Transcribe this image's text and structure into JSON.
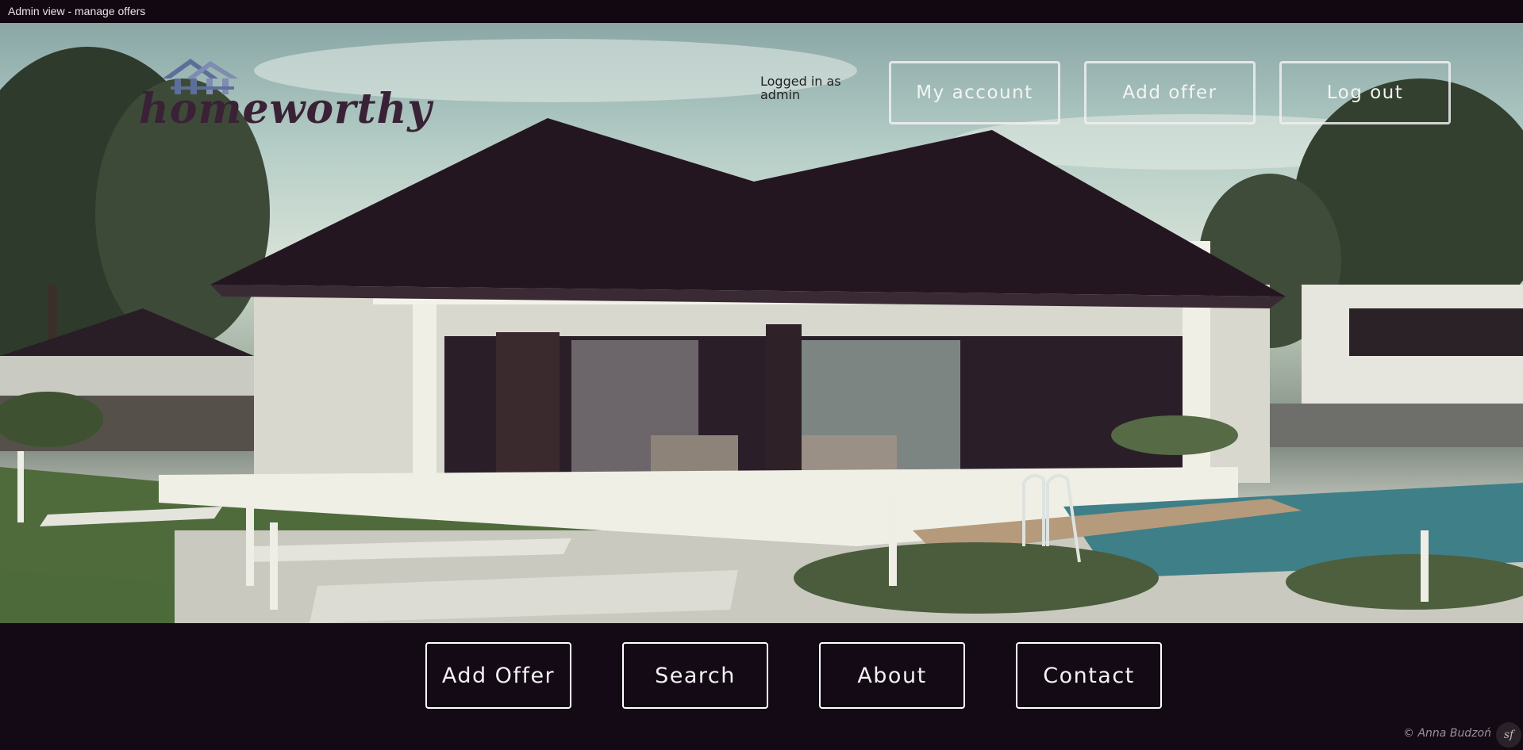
{
  "window": {
    "title": "Admin view - manage offers"
  },
  "brand": {
    "name": "homeworthy"
  },
  "session": {
    "status": "Logged in as admin"
  },
  "top_nav": {
    "my_account": "My account",
    "add_offer": "Add offer",
    "log_out": "Log out"
  },
  "main_nav": {
    "add_offer": "Add Offer",
    "search": "Search",
    "about": "About",
    "contact": "Contact"
  },
  "footer": {
    "copyright": "© Anna Budzoń",
    "badge": "sf"
  },
  "colors": {
    "background": "#140a16",
    "button_border": "#ffffff",
    "logo_text": "#3a2236",
    "logo_icon": "#5c6f9a"
  }
}
